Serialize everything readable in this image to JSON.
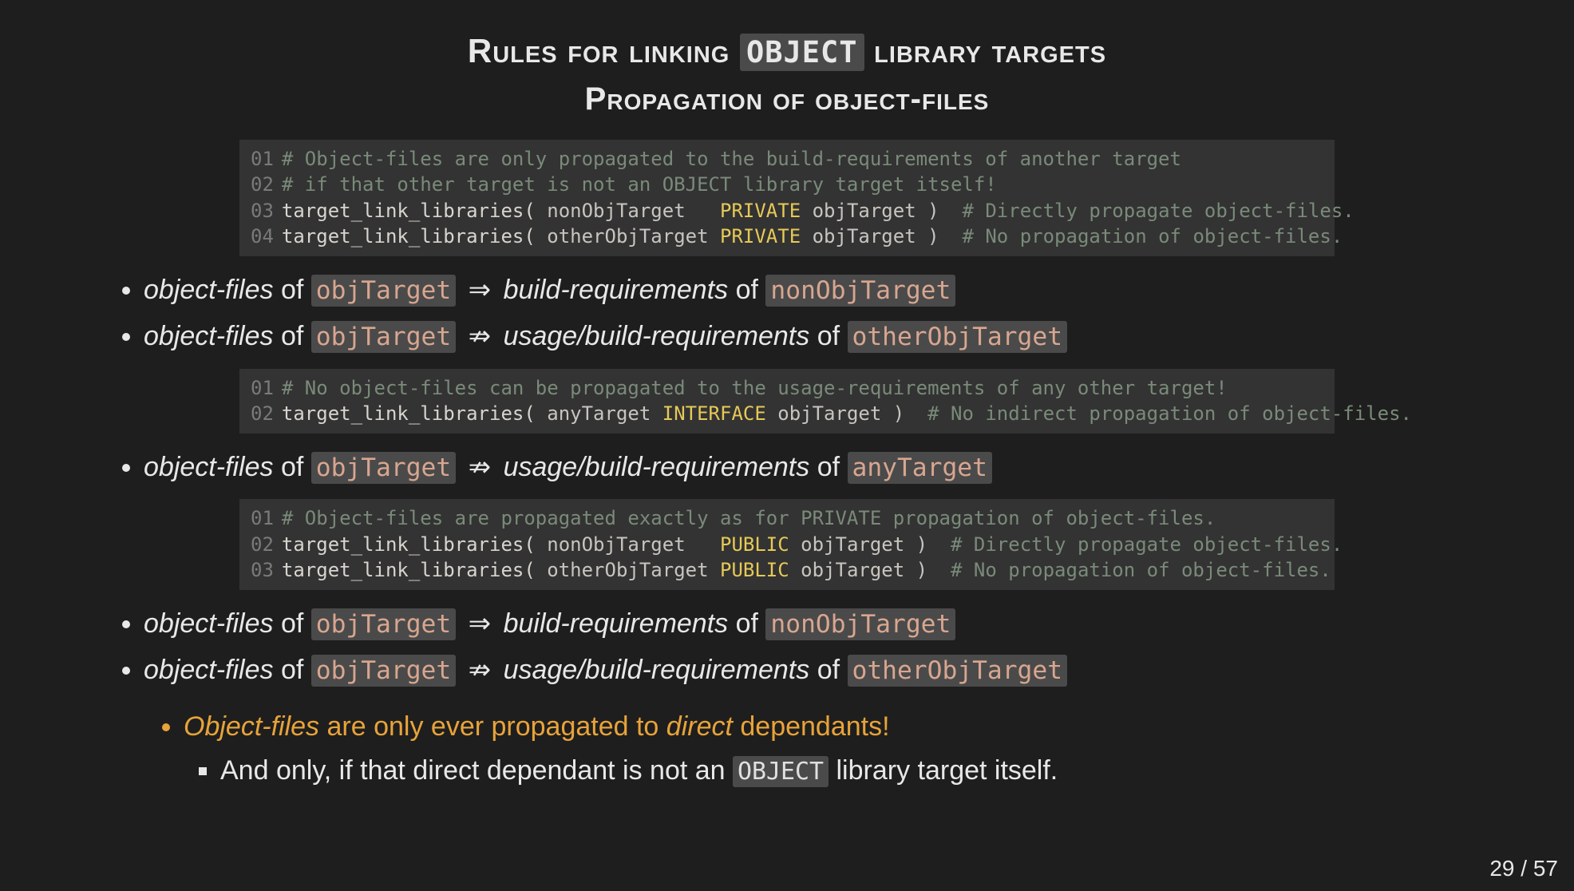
{
  "title": {
    "pre": "Rules for linking ",
    "code": "OBJECT",
    "post": " library targets"
  },
  "subtitle": "Propagation of object-files",
  "code1": {
    "l1_ln": "01",
    "l1": "# Object-files are only propagated to the build-requirements of another target",
    "l2_ln": "02",
    "l2": "# if that other target is not an OBJECT library target itself!",
    "l3_ln": "03",
    "l3_fn": "target_link_libraries( ",
    "l3_t": "nonObjTarget   ",
    "l3_kw": "PRIVATE",
    "l3_a": " objTarget )  ",
    "l3_c": "# Directly propagate object-files.",
    "l4_ln": "04",
    "l4_fn": "target_link_libraries( ",
    "l4_t": "otherObjTarget ",
    "l4_kw": "PRIVATE",
    "l4_a": " objTarget )  ",
    "l4_c": "# No propagation of object-files."
  },
  "bul1": {
    "a_pre": "object-files",
    "a_of": " of ",
    "a_code": "objTarget",
    "a_arrow": " ⇒ ",
    "a_mid": "build-requirements",
    "a_of2": " of ",
    "a_code2": "nonObjTarget",
    "b_pre": "object-files",
    "b_of": " of ",
    "b_code": "objTarget",
    "b_arrow": " ⇏ ",
    "b_mid": "usage/build-requirements",
    "b_of2": " of ",
    "b_code2": "otherObjTarget"
  },
  "code2": {
    "l1_ln": "01",
    "l1": "# No object-files can be propagated to the usage-requirements of any other target!",
    "l2_ln": "02",
    "l2_fn": "target_link_libraries( ",
    "l2_t": "anyTarget ",
    "l2_kw": "INTERFACE",
    "l2_a": " objTarget )  ",
    "l2_c": "# No indirect propagation of object-files."
  },
  "bul2": {
    "a_pre": "object-files",
    "a_of": " of ",
    "a_code": "objTarget",
    "a_arrow": " ⇏ ",
    "a_mid": "usage/build-requirements",
    "a_of2": " of ",
    "a_code2": "anyTarget"
  },
  "code3": {
    "l1_ln": "01",
    "l1": "# Object-files are propagated exactly as for PRIVATE propagation of object-files.",
    "l2_ln": "02",
    "l2_fn": "target_link_libraries( ",
    "l2_t": "nonObjTarget   ",
    "l2_kw": "PUBLIC",
    "l2_a": " objTarget )  ",
    "l2_c": "# Directly propagate object-files.",
    "l3_ln": "03",
    "l3_fn": "target_link_libraries( ",
    "l3_t": "otherObjTarget ",
    "l3_kw": "PUBLIC",
    "l3_a": " objTarget )  ",
    "l3_c": "# No propagation of object-files."
  },
  "bul3": {
    "a_pre": "object-files",
    "a_of": " of ",
    "a_code": "objTarget",
    "a_arrow": " ⇒ ",
    "a_mid": "build-requirements",
    "a_of2": " of ",
    "a_code2": "nonObjTarget",
    "b_pre": "object-files",
    "b_of": " of ",
    "b_code": "objTarget",
    "b_arrow": " ⇏ ",
    "b_mid": "usage/build-requirements",
    "b_of2": " of ",
    "b_code2": "otherObjTarget"
  },
  "summary": {
    "line1_a": "Object-files",
    "line1_b": " are only ever propagated to ",
    "line1_c": "direct",
    "line1_d": " dependants!",
    "line2_a": "And only, if that direct dependant is not an ",
    "line2_b": "OBJECT",
    "line2_c": " library target itself."
  },
  "pagenum": "29 / 57"
}
